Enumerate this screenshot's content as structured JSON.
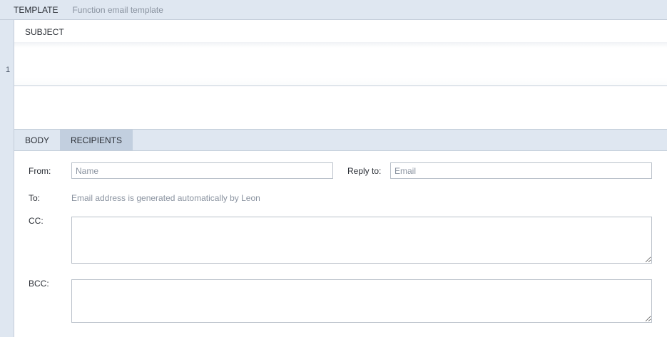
{
  "header": {
    "template_label": "TEMPLATE",
    "template_name": "Function email template"
  },
  "editor": {
    "line_number": "1",
    "subject_label": "SUBJECT",
    "subject_value": ""
  },
  "tabs": [
    {
      "label": "BODY",
      "active": false
    },
    {
      "label": "RECIPIENTS",
      "active": true
    }
  ],
  "recipients": {
    "from_label": "From:",
    "from_placeholder": "Name",
    "from_value": "",
    "reply_to_label": "Reply to:",
    "reply_to_placeholder": "Email",
    "reply_to_value": "",
    "to_label": "To:",
    "to_info": "Email address is generated automatically by Leon",
    "cc_label": "CC:",
    "cc_value": "",
    "bcc_label": "BCC:",
    "bcc_value": ""
  },
  "colors": {
    "background": "#dfe7f1",
    "active_tab": "#c2cfdf",
    "border": "#c4ceda",
    "muted_text": "#8a93a0"
  }
}
